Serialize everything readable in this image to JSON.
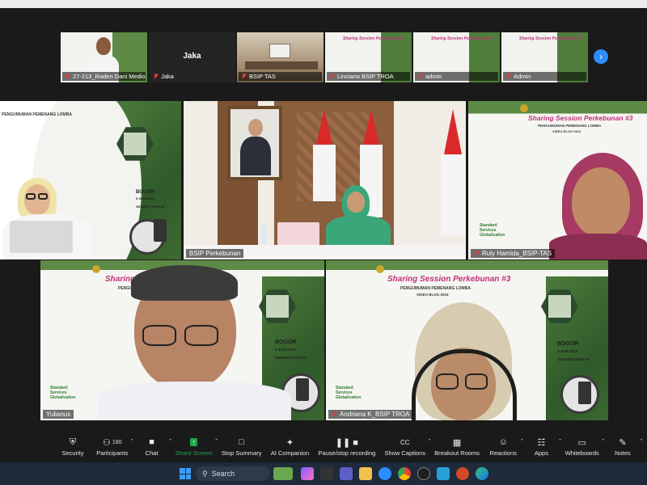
{
  "thumbnails": [
    {
      "name": "27-213_Raden Dani Medio...",
      "muted": true
    },
    {
      "name": "Jaka",
      "muted": true,
      "camera_off": true
    },
    {
      "name": "BSIP TAS",
      "muted": true
    },
    {
      "name": "Linciana BSIP TROA",
      "muted": true
    },
    {
      "name": "admin",
      "muted": true
    },
    {
      "name": "Admin",
      "muted": true
    }
  ],
  "tiles": {
    "top_left": {
      "name": ""
    },
    "top_center": {
      "name": "BSIP Perkebunan"
    },
    "top_right": {
      "name": "Ruly Hamida_BSIP-TAS"
    },
    "bottom_left": {
      "name": "Yulianus"
    },
    "bottom_right": {
      "name": "Andriana K_BSIP TROA"
    }
  },
  "slide": {
    "title": "Sharing Session Perkebunan #3",
    "subtitle": "PENGUMUMAN PEMENANG LOMBA",
    "subtitle2": "VIDEO BLOG 2024",
    "location": "BOGOR",
    "date": "5 JUNI 2024",
    "venue": "GEDUNG DISPLAY",
    "standard": [
      "Standard",
      "Services",
      "Globalization"
    ]
  },
  "toolbar": [
    {
      "label": "Security",
      "icon": "shield-icon"
    },
    {
      "label": "Participants",
      "icon": "participants-icon",
      "count": "180",
      "caret": true
    },
    {
      "label": "Chat",
      "icon": "chat-icon",
      "caret": true
    },
    {
      "label": "Share Screen",
      "icon": "share-screen-icon",
      "caret": true,
      "active": true
    },
    {
      "label": "Stop Summary",
      "icon": "summary-icon"
    },
    {
      "label": "AI Companion",
      "icon": "ai-companion-icon"
    },
    {
      "label": "Pause/stop recording",
      "icon": "recording-icon"
    },
    {
      "label": "Show Captions",
      "icon": "captions-icon",
      "caret": true
    },
    {
      "label": "Breakout Rooms",
      "icon": "breakout-rooms-icon"
    },
    {
      "label": "Reactions",
      "icon": "reactions-icon",
      "caret": true
    },
    {
      "label": "Apps",
      "icon": "apps-icon",
      "caret": true
    },
    {
      "label": "Whiteboards",
      "icon": "whiteboard-icon",
      "caret": true
    },
    {
      "label": "Notes",
      "icon": "notes-icon",
      "caret": true
    }
  ],
  "taskbar": {
    "search_placeholder": "Search"
  },
  "colors": {
    "accent": "#2d8cff",
    "share_green": "#1ea54d",
    "mic_off_red": "#e03b3b",
    "active_speaker": "#e6d44a"
  }
}
